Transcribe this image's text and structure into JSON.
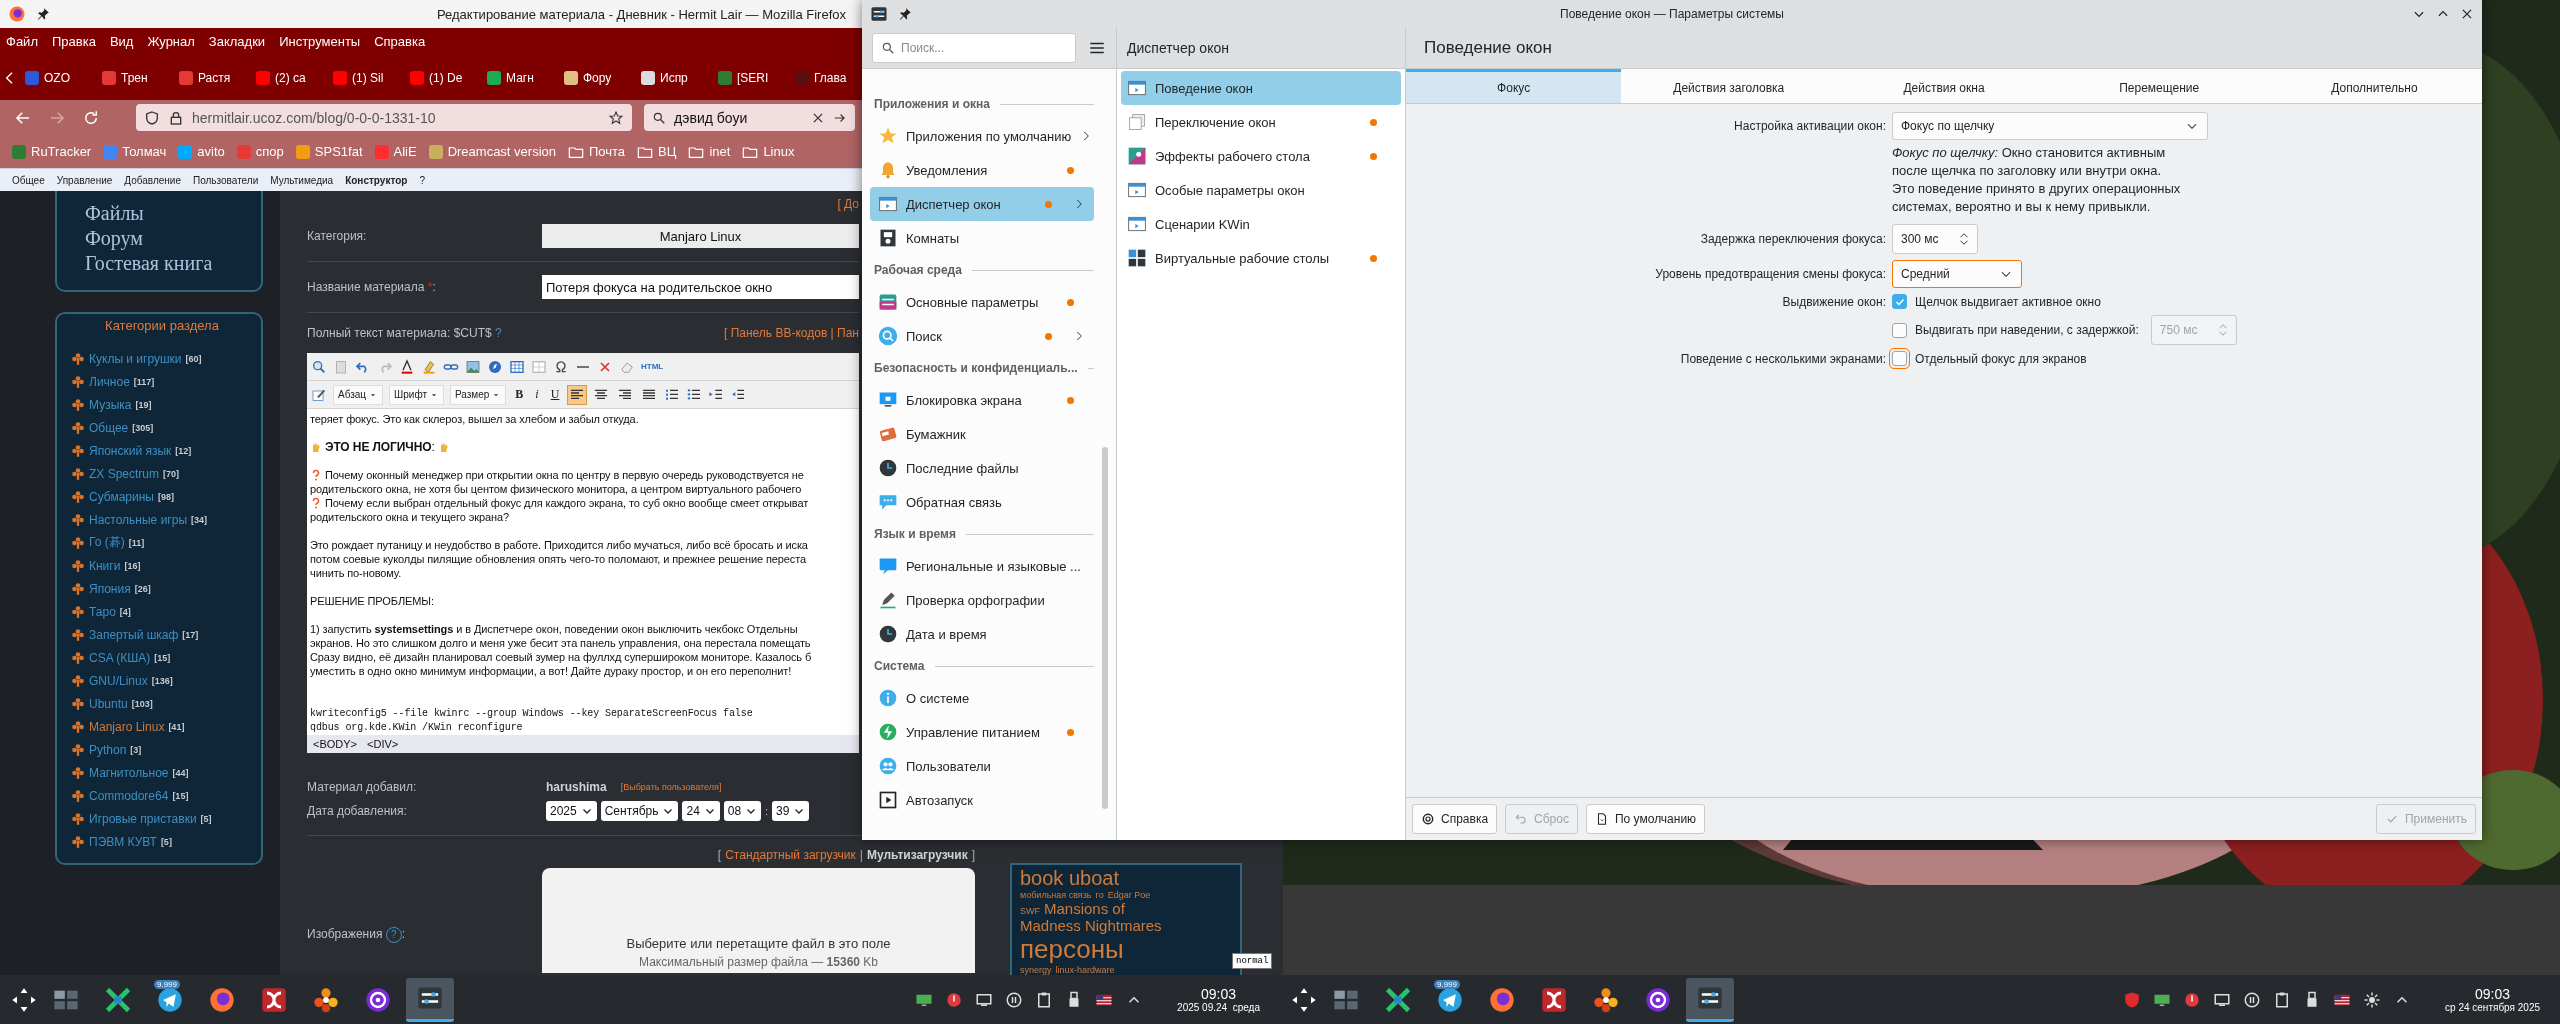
{
  "firefox": {
    "title": "Редактирование материала - Дневник - Hermit Lair — Mozilla Firefox",
    "menu": [
      "Файл",
      "Правка",
      "Вид",
      "Журнал",
      "Закладки",
      "Инструменты",
      "Справка"
    ],
    "tabs": [
      {
        "label": "OZO",
        "selected": false,
        "color": "#2b5bdc"
      },
      {
        "label": "Трен",
        "selected": false,
        "color": "#e53935"
      },
      {
        "label": "Растя",
        "selected": false,
        "color": "#e53935"
      },
      {
        "label": "(2) ca",
        "selected": false,
        "color": "#ff0000"
      },
      {
        "label": "(1) Sil",
        "selected": false,
        "color": "#ff0000"
      },
      {
        "label": "(1) De",
        "selected": false,
        "color": "#ff0000"
      },
      {
        "label": "Магн",
        "selected": false,
        "color": "#1faa59"
      },
      {
        "label": "Фору",
        "selected": false,
        "color": "#e0c080"
      },
      {
        "label": "Испр",
        "selected": false,
        "color": "#dddddd"
      },
      {
        "label": "[SERI",
        "selected": false,
        "color": "#2e7d32"
      },
      {
        "label": "Глава",
        "selected": false,
        "color": "#5a1010"
      }
    ],
    "url": "hermitlair.ucoz.com/blog/0-0-0-1331-10",
    "search": {
      "value": "дэвид боуи"
    },
    "bookmarks": [
      {
        "label": "RuTracker",
        "kind": "site",
        "color": "#2e7d32"
      },
      {
        "label": "Толмач",
        "kind": "site",
        "color": "#4285f4"
      },
      {
        "label": "avito",
        "kind": "site",
        "color": "#00aaff"
      },
      {
        "label": "спор",
        "kind": "site",
        "color": "#e53935"
      },
      {
        "label": "SPS1fat",
        "kind": "site",
        "color": "#f39c12"
      },
      {
        "label": "AliE",
        "kind": "site",
        "color": "#ff2d2d"
      },
      {
        "label": "Dreamcast version",
        "kind": "site",
        "color": "#c6b15a"
      },
      {
        "label": "Почта",
        "kind": "folder"
      },
      {
        "label": "ВЦ",
        "kind": "folder"
      },
      {
        "label": "inet",
        "kind": "folder"
      },
      {
        "label": "Linux",
        "kind": "folder"
      }
    ],
    "admin_menu": [
      {
        "label": "Общее",
        "selected": false
      },
      {
        "label": "Управление",
        "selected": false
      },
      {
        "label": "Добавление",
        "selected": false
      },
      {
        "label": "Пользователи",
        "selected": false
      },
      {
        "label": "Мультимедиа",
        "selected": false
      },
      {
        "label": "Конструктор",
        "selected": true
      },
      {
        "label": "?",
        "selected": false
      }
    ]
  },
  "page": {
    "nav_links": [
      "Файлы",
      "Форум",
      "Гостевая книга"
    ],
    "categories": {
      "title": "Категории раздела",
      "items": [
        {
          "name": "Куклы и игрушки",
          "count": "[60]",
          "selected": false
        },
        {
          "name": "Личное",
          "count": "[117]",
          "selected": false
        },
        {
          "name": "Музыка",
          "count": "[19]",
          "selected": false
        },
        {
          "name": "Общее",
          "count": "[305]",
          "selected": false
        },
        {
          "name": "Японский язык",
          "count": "[12]",
          "selected": false
        },
        {
          "name": "ZX Spectrum",
          "count": "[70]",
          "selected": false
        },
        {
          "name": "Субмарины",
          "count": "[98]",
          "selected": false
        },
        {
          "name": "Настольные игры",
          "count": "[34]",
          "selected": false
        },
        {
          "name": "Го (碁)",
          "count": "[11]",
          "selected": false
        },
        {
          "name": "Книги",
          "count": "[16]",
          "selected": false
        },
        {
          "name": "Япония",
          "count": "[26]",
          "selected": false
        },
        {
          "name": "Таро",
          "count": "[4]",
          "selected": false
        },
        {
          "name": "Запертый шкаф",
          "count": "[17]",
          "selected": false
        },
        {
          "name": "CSA (КША)",
          "count": "[15]",
          "selected": false
        },
        {
          "name": "GNU/Linux",
          "count": "[136]",
          "selected": false
        },
        {
          "name": "Ubuntu",
          "count": "[103]",
          "selected": false
        },
        {
          "name": "Manjaro Linux",
          "count": "[41]",
          "selected": true
        },
        {
          "name": "Python",
          "count": "[3]",
          "selected": false
        },
        {
          "name": "Магнитольное",
          "count": "[44]",
          "selected": false
        },
        {
          "name": "Commodore64",
          "count": "[15]",
          "selected": false
        },
        {
          "name": "Игровые приставки",
          "count": "[5]",
          "selected": false
        },
        {
          "name": "ПЭВМ КУВТ",
          "count": "[5]",
          "selected": false
        }
      ]
    },
    "top_link": "[ До",
    "category": {
      "label": "Категория:",
      "value": "Manjaro Linux"
    },
    "title_field": {
      "label": "Название материала",
      "required_mark": "*",
      "label_end": ":",
      "value": "Потеря фокуса на родительское окно"
    },
    "fulltext": {
      "label": "Полный текст материала: $CUT$",
      "help": "?",
      "links": "[ Панель BB-кодов | Пан"
    },
    "editor": {
      "html_label": "HTML",
      "dropdowns": [
        "Абзац",
        "Шрифт",
        "Размер"
      ],
      "style_buttons": [
        {
          "label": "B",
          "kind": "bold"
        },
        {
          "label": "i",
          "kind": "italic"
        },
        {
          "label": "U",
          "kind": "underline"
        }
      ],
      "align_buttons": [
        {
          "selected": true
        },
        {
          "selected": false
        },
        {
          "selected": false
        },
        {
          "selected": false
        }
      ],
      "paragraphs": [
        {
          "kind": "text",
          "lines": [
            {
              "kind": "plain",
              "text": "теряет фокус. Это как склероз, вышел за хлебом и забыл откуда."
            }
          ]
        },
        {
          "kind": "heading",
          "lines": [
            {
              "kind": "plain",
              "text": "**ЭТО НЕ ЛОГИЧНО**:"
            }
          ]
        },
        {
          "kind": "text",
          "lines": [
            {
              "kind": "question",
              "text": "Почему оконный менеджер при открытии окна по центру в первую очередь руководствуется не"
            },
            {
              "kind": "plain",
              "text": "родительского окна, не хотя бы центом физического монитора, а центром виртуального рабочего"
            },
            {
              "kind": "question",
              "text": " Почему если выбран отдельный фокус для каждого экрана, то суб окно вообще смеет открыват"
            },
            {
              "kind": "plain",
              "text": "родительского окна и текущего экрана?"
            }
          ]
        },
        {
          "kind": "text",
          "lines": [
            {
              "kind": "plain",
              "text": "Это рождает путаницу и неудобство в работе. Приходится либо мучаться, либо всё бросать и иска"
            },
            {
              "kind": "plain",
              "text": "потом соевые куколды пилящие обновления опять чего-то поломают, и прежнее решение переста"
            },
            {
              "kind": "plain",
              "text": "чинить по-новому."
            }
          ]
        },
        {
          "kind": "text",
          "lines": [
            {
              "kind": "plain",
              "text": "РЕШЕНИЕ ПРОБЛЕМЫ:"
            }
          ]
        },
        {
          "kind": "text",
          "lines": [
            {
              "kind": "plain",
              "text": "1) запустить **systemsettings**  и в Диспетчере окон, поведении окон выключить чекбокс Отдельны"
            },
            {
              "kind": "plain",
              "text": "экранов. Но это слишком долго и меня уже бесит эта панель управления, она перестала помещать"
            },
            {
              "kind": "plain",
              "text": "Сразу видно, её дизайн планировал соевый зумер на фуллхд супершироком мониторе. Казалось б"
            },
            {
              "kind": "plain",
              "text": "уместить в одно окно минимум информации, а вот! Дайте дураку простор, и он его переполнит!"
            }
          ]
        },
        {
          "kind": "code",
          "lines": [
            {
              "kind": "plain",
              "text": "kwriteconfig5 --file kwinrc --group Windows --key SeparateScreenFocus false"
            },
            {
              "kind": "plain",
              "text": "qdbus org.kde.KWin /KWin reconfigure"
            }
          ]
        }
      ],
      "status": [
        "<BODY>",
        "<DIV>"
      ]
    },
    "author": {
      "label": "Материал добавил:",
      "value": "harushima",
      "link": "[Выбрать пользователя]"
    },
    "date": {
      "label": "Дата добавления:",
      "selects": [
        "2025",
        "Сентябрь",
        "24",
        "08",
        "39"
      ],
      "time_separator": ":"
    },
    "loaders": {
      "open": "[",
      "separator": "|",
      "close": "]",
      "items": [
        {
          "label": "Стандартный загрузчик",
          "selected": false
        },
        {
          "label": "Мультизагрузчик",
          "selected": true
        }
      ]
    },
    "images": {
      "label": "Изображения",
      "help": "?",
      "label_end": ":"
    },
    "dropzone": {
      "title": "Выберите или перетащите файл в это поле",
      "limit": "Максимальный размер файла — **15360** Kb"
    },
    "tag_cloud": [
      [
        {
          "text": "book uboat",
          "kind": "large"
        }
      ],
      [
        {
          "text": "мобильная связь",
          "kind": "small"
        },
        {
          "text": "го",
          "kind": "small"
        },
        {
          "text": "Edgar Poe",
          "kind": "small"
        }
      ],
      [
        {
          "text": "SWF",
          "kind": "small"
        },
        {
          "text": "Mansions of",
          "kind": "medium"
        }
      ],
      [
        {
          "text": "Madness",
          "kind": "medium"
        },
        {
          "text": "Nightmares",
          "kind": "medium"
        }
      ],
      [
        {
          "text": "персоны",
          "kind": "huge"
        }
      ],
      [
        {
          "text": "synergy",
          "kind": "small"
        },
        {
          "text": "linux-hardware",
          "kind": "small"
        }
      ]
    ],
    "layout_label": "normal"
  },
  "settings": {
    "title": "Поведение окон — Параметры системы",
    "search": {
      "placeholder": "Поиск..."
    },
    "sidebar": {
      "sections": [
        {
          "title": "Приложения и окна",
          "items": [
            {
              "label": "Приложения по умолчанию",
              "selected": false,
              "modified": false,
              "expandable": true
            },
            {
              "label": "Уведомления",
              "selected": false,
              "modified": true,
              "expandable": false
            },
            {
              "label": "Диспетчер окон",
              "selected": true,
              "modified": true,
              "expandable": true
            },
            {
              "label": "Комнаты",
              "selected": false,
              "modified": false,
              "expandable": false
            }
          ]
        },
        {
          "title": "Рабочая среда",
          "items": [
            {
              "label": "Основные параметры",
              "selected": false,
              "modified": true,
              "expandable": false
            },
            {
              "label": "Поиск",
              "selected": false,
              "modified": true,
              "expandable": true
            }
          ]
        },
        {
          "title": "Безопасность и конфиденциаль...",
          "items": [
            {
              "label": "Блокировка экрана",
              "selected": false,
              "modified": true,
              "expandable": false
            },
            {
              "label": "Бумажник",
              "selected": false,
              "modified": false,
              "expandable": false
            },
            {
              "label": "Последние файлы",
              "selected": false,
              "modified": false,
              "expandable": false
            },
            {
              "label": "Обратная связь",
              "selected": false,
              "modified": false,
              "expandable": false
            }
          ]
        },
        {
          "title": "Язык и время",
          "items": [
            {
              "label": "Региональные и языковые ...",
              "selected": false,
              "modified": false,
              "expandable": false
            },
            {
              "label": "Проверка орфографии",
              "selected": false,
              "modified": false,
              "expandable": false
            },
            {
              "label": "Дата и время",
              "selected": false,
              "modified": false,
              "expandable": false
            }
          ]
        },
        {
          "title": "Система",
          "items": [
            {
              "label": "О системе",
              "selected": false,
              "modified": false,
              "expandable": false
            },
            {
              "label": "Управление питанием",
              "selected": false,
              "modified": true,
              "expandable": false
            },
            {
              "label": "Пользователи",
              "selected": false,
              "modified": false,
              "expandable": false
            },
            {
              "label": "Автозапуск",
              "selected": false,
              "modified": false,
              "expandable": false
            }
          ]
        }
      ]
    },
    "middle": {
      "title": "Диспетчер окон",
      "items": [
        {
          "label": "Поведение окон",
          "selected": true,
          "modified": false
        },
        {
          "label": "Переключение окон",
          "selected": false,
          "modified": true
        },
        {
          "label": "Эффекты рабочего стола",
          "selected": false,
          "modified": true
        },
        {
          "label": "Особые параметры окон",
          "selected": false,
          "modified": false
        },
        {
          "label": "Сценарии KWin",
          "selected": false,
          "modified": false
        },
        {
          "label": "Виртуальные рабочие столы",
          "selected": false,
          "modified": true
        }
      ]
    },
    "page_title": "Поведение окон",
    "tabs": [
      {
        "label": "Фокус",
        "selected": true
      },
      {
        "label": "Действия заголовка",
        "selected": false
      },
      {
        "label": "Действия окна",
        "selected": false
      },
      {
        "label": "Перемещение",
        "selected": false
      },
      {
        "label": "Дополнительно",
        "selected": false
      }
    ],
    "form": [
      {
        "kind": "combo",
        "label": "Настройка активации окон:",
        "value": "Фокус по щелчку",
        "focused": false
      },
      {
        "kind": "note",
        "text": "*Фокус по щелчку:* Окно становится активным после щелчка по заголовку или внутри окна. Это поведение принято в других операционных системах, вероятно и вы к нему привыкли."
      },
      {
        "kind": "spin",
        "label": "Задержка переключения фокуса:",
        "value": "300 мс",
        "disabled": false
      },
      {
        "kind": "combo",
        "label": "Уровень предотвращения смены фокуса:",
        "value": "Средний",
        "focused": true
      },
      {
        "kind": "check",
        "label": "Выдвижение окон:",
        "text": "Щелчок выдвигает активное окно",
        "checked": true,
        "focused": false
      },
      {
        "kind": "check_spin",
        "text": "Выдвигать при наведении, с задержкой:",
        "checked": false,
        "value": "750 мс",
        "disabled": true
      },
      {
        "kind": "check",
        "label": "Поведение с несколькими экранами:",
        "text": "Отдельный фокус для экранов",
        "checked": false,
        "focused": true
      }
    ],
    "buttons_left": [
      {
        "label": "Справка",
        "kind": "help",
        "disabled": false
      },
      {
        "label": "Сброс",
        "kind": "reset",
        "disabled": true
      },
      {
        "label": "По умолчанию",
        "kind": "defaults",
        "disabled": false
      }
    ],
    "button_apply": {
      "label": "Применить",
      "disabled": true
    }
  },
  "taskbars": [
    {
      "apps": [
        {
          "kind": "pager",
          "active": false
        },
        {
          "kind": "xapp",
          "active": false
        },
        {
          "kind": "messenger",
          "active": false,
          "badge": "9.999"
        },
        {
          "kind": "browser",
          "active": false
        },
        {
          "kind": "dc",
          "active": false
        },
        {
          "kind": "viewer",
          "active": false
        },
        {
          "kind": "player",
          "active": false
        },
        {
          "kind": "settings",
          "active": true
        }
      ],
      "tray": [
        {
          "kind": "display"
        },
        {
          "kind": "alert"
        },
        {
          "kind": "network"
        },
        {
          "kind": "pause"
        },
        {
          "kind": "clipboard"
        },
        {
          "kind": "usb"
        },
        {
          "kind": "flag"
        },
        {
          "kind": "expand"
        }
      ],
      "clock": {
        "time": "09:03",
        "date": "2025 09.24  среда"
      }
    },
    {
      "apps": [
        {
          "kind": "pager",
          "active": false
        },
        {
          "kind": "xapp",
          "active": false
        },
        {
          "kind": "messenger",
          "active": false,
          "badge": "9.999"
        },
        {
          "kind": "browser",
          "active": false
        },
        {
          "kind": "dc",
          "active": false
        },
        {
          "kind": "viewer",
          "active": false
        },
        {
          "kind": "player",
          "active": false
        },
        {
          "kind": "settings",
          "active": true
        }
      ],
      "tray": [
        {
          "kind": "shield"
        },
        {
          "kind": "display"
        },
        {
          "kind": "alert"
        },
        {
          "kind": "network"
        },
        {
          "kind": "pause"
        },
        {
          "kind": "clipboard"
        },
        {
          "kind": "usb"
        },
        {
          "kind": "flag"
        },
        {
          "kind": "brightness"
        },
        {
          "kind": "expand"
        }
      ],
      "clock": {
        "time": "09:03",
        "date": "ср 24 сентября 2025"
      }
    }
  ]
}
